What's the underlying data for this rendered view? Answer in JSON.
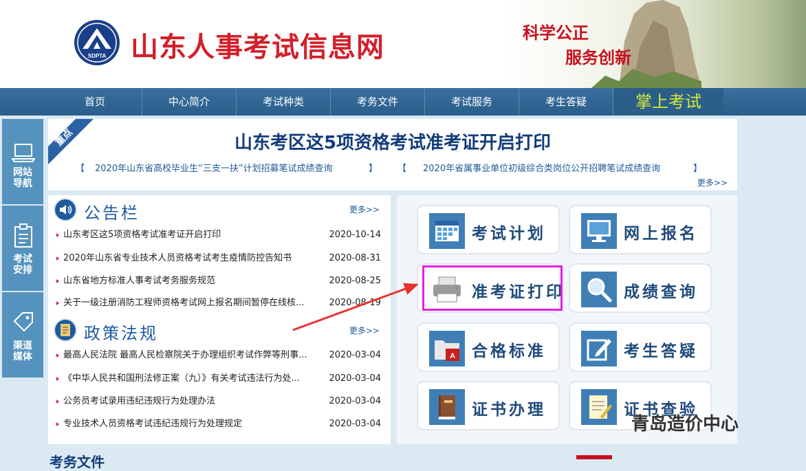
{
  "header": {
    "logo_text": "SDPTA",
    "site_title": "山东人事考试信息网",
    "slogan_line1": "科学公正",
    "slogan_line2": "服务创新"
  },
  "nav": {
    "items": [
      "首页",
      "中心简介",
      "考试种类",
      "考务文件",
      "考试服务",
      "考生答疑"
    ],
    "mobile_label": "掌上考试"
  },
  "sidebar": {
    "tabs": [
      {
        "label_line1": "网站",
        "label_line2": "导航",
        "icon": "laptop-icon"
      },
      {
        "label_line1": "考试",
        "label_line2": "安排",
        "icon": "clipboard-icon"
      },
      {
        "label_line1": "渠道",
        "label_line2": "媒体",
        "icon": "tag-icon"
      }
    ]
  },
  "banner": {
    "ribbon_label": "重点",
    "headline": "山东考区这5项资格考试准考证开启打印",
    "sub_links": [
      "2020年山东省高校毕业生“三支一扶”计划招募笔试成绩查询",
      "2020年省属事业单位初级综合类岗位公开招聘笔试成绩查询"
    ],
    "bracket_open": "【",
    "bracket_close": "】",
    "more": "更多>>"
  },
  "bulletin": {
    "title": "公告栏",
    "more": "更多>>",
    "items": [
      {
        "title": "山东考区这5项资格考试准考证开启打印",
        "date": "2020-10-14"
      },
      {
        "title": "2020年山东省专业技术人员资格考试考生疫情防控告知书",
        "date": "2020-08-31"
      },
      {
        "title": "山东省地方标准人事考试考务服务规范",
        "date": "2020-08-25"
      },
      {
        "title": "关于一级注册消防工程师资格考试网上报名期间暂停在线核...",
        "date": "2020-08-19"
      }
    ]
  },
  "policy": {
    "title": "政策法规",
    "more": "更多>>",
    "items": [
      {
        "title": "最高人民法院 最高人民检察院关于办理组织考试作弊等刑事...",
        "date": "2020-03-04"
      },
      {
        "title": "《中华人民共和国刑法修正案（九）》有关考试违法行为处...",
        "date": "2020-03-04"
      },
      {
        "title": "公务员考试录用违纪违规行为处理办法",
        "date": "2020-03-04"
      },
      {
        "title": "专业技术人员资格考试违纪违规行为处理规定",
        "date": "2020-03-04"
      }
    ]
  },
  "services": [
    {
      "label": "考试计划",
      "icon": "calendar-icon"
    },
    {
      "label": "网上报名",
      "icon": "monitor-icon"
    },
    {
      "label": "准考证打印",
      "icon": "printer-icon"
    },
    {
      "label": "成绩查询",
      "icon": "magnifier-icon"
    },
    {
      "label": "合格标准",
      "icon": "folder-pdf-icon"
    },
    {
      "label": "考生答疑",
      "icon": "edit-icon"
    },
    {
      "label": "证书办理",
      "icon": "book-icon"
    },
    {
      "label": "证书查验",
      "icon": "notepad-icon"
    }
  ],
  "colors": {
    "brand_red": "#d2202a",
    "nav_blue": "#2a5e8b",
    "highlight": "#e61ee6"
  },
  "watermark": "青岛造价中心",
  "below": {
    "section_title": "考务文件"
  }
}
